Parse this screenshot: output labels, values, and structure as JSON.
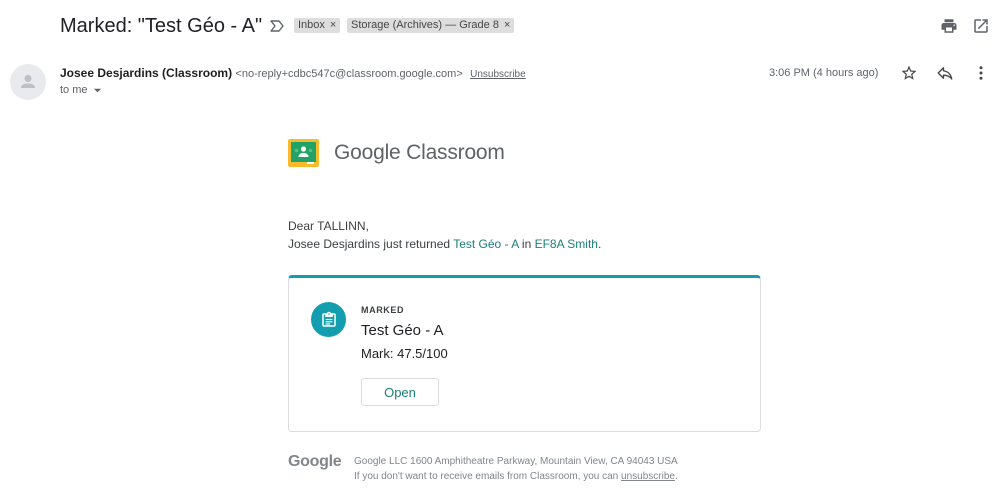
{
  "subject": "Marked: \"Test Géo - A\"",
  "labels": [
    {
      "name": "Inbox",
      "remove": "×"
    },
    {
      "name": "Storage (Archives) — Grade 8",
      "remove": "×"
    }
  ],
  "header_icons": [
    "print-icon",
    "open-in-new-window-icon"
  ],
  "sender": {
    "name": "Josee Desjardins (Classroom)",
    "email": "<no-reply+cdbc547c@classroom.google.com>",
    "unsubscribe": "Unsubscribe",
    "to": "to me"
  },
  "timestamp": "3:06 PM (4 hours ago)",
  "message_icons": [
    "star-icon",
    "reply-icon",
    "more-vert-icon"
  ],
  "body": {
    "logo_text": "Google Classroom",
    "greeting": "Dear TALLINN,",
    "returned": {
      "prefix": "Josee Desjardins just returned ",
      "assignment": "Test Géo - A",
      "middle": " in ",
      "class": "EF8A Smith",
      "suffix": "."
    },
    "card": {
      "status": "MARKED",
      "title": "Test Géo - A",
      "mark": "Mark: 47.5/100",
      "open_button": "Open"
    }
  },
  "footer": {
    "logo": "Google",
    "address": "Google LLC 1600 Amphitheatre Parkway, Mountain View, CA 94043 USA",
    "unsub_prefix": "If you don't want to receive emails from Classroom, you can ",
    "unsub_link": "unsubscribe",
    "unsub_suffix": "."
  },
  "colors": {
    "accent_teal": "#129eaf",
    "link_teal": "#1a7f7a",
    "label_chip": "#dddddd"
  }
}
